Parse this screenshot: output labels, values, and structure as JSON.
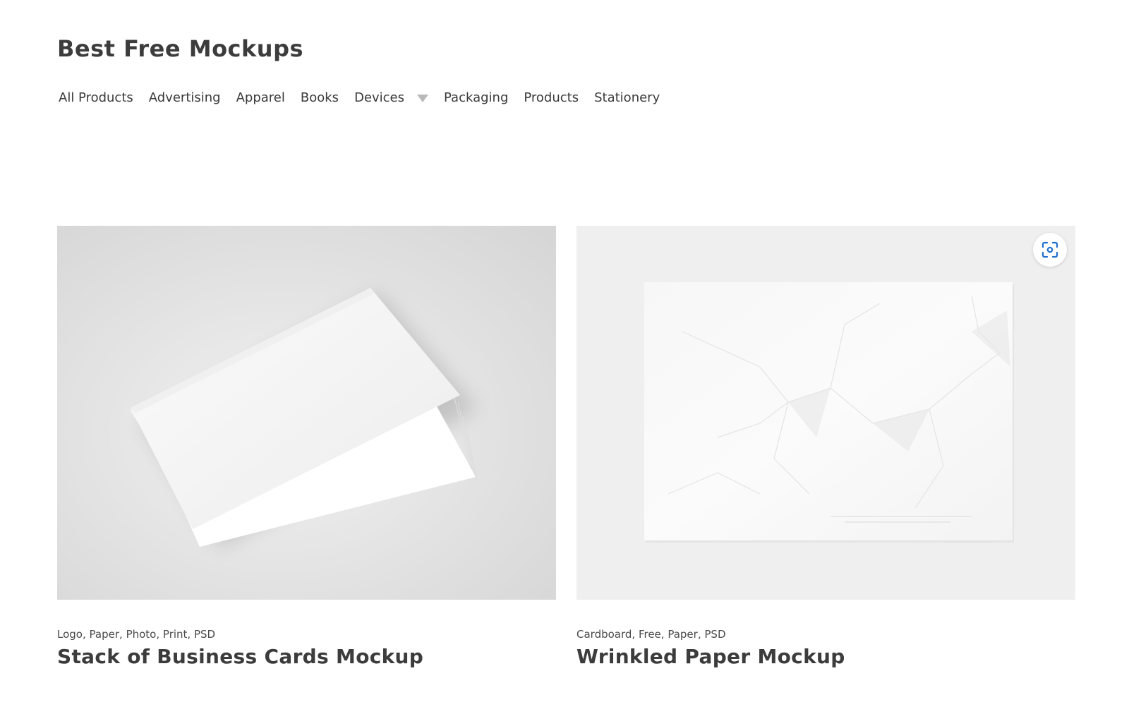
{
  "site": {
    "title": "Best Free Mockups"
  },
  "nav": {
    "items": [
      {
        "label": "All Products"
      },
      {
        "label": "Advertising"
      },
      {
        "label": "Apparel"
      },
      {
        "label": "Books"
      },
      {
        "label": "Devices",
        "has_dropdown": true
      },
      {
        "label": "Packaging"
      },
      {
        "label": "Products"
      },
      {
        "label": "Stationery"
      }
    ]
  },
  "products": [
    {
      "tags": [
        "Logo",
        "Paper",
        "Photo",
        "Print",
        "PSD"
      ],
      "title": "Stack of Business Cards Mockup",
      "image_icon": "business-cards-stack"
    },
    {
      "tags": [
        "Cardboard",
        "Free",
        "Paper",
        "PSD"
      ],
      "title": "Wrinkled Paper Mockup",
      "image_icon": "wrinkled-paper-sheet",
      "overlay_icon": "visual-search-icon"
    }
  ],
  "colors": {
    "text": "#3a3a3a",
    "accent_icon": "#1f6fd1",
    "thumb_bg_left": "#dcdcdc",
    "thumb_bg_right": "#efefef"
  }
}
